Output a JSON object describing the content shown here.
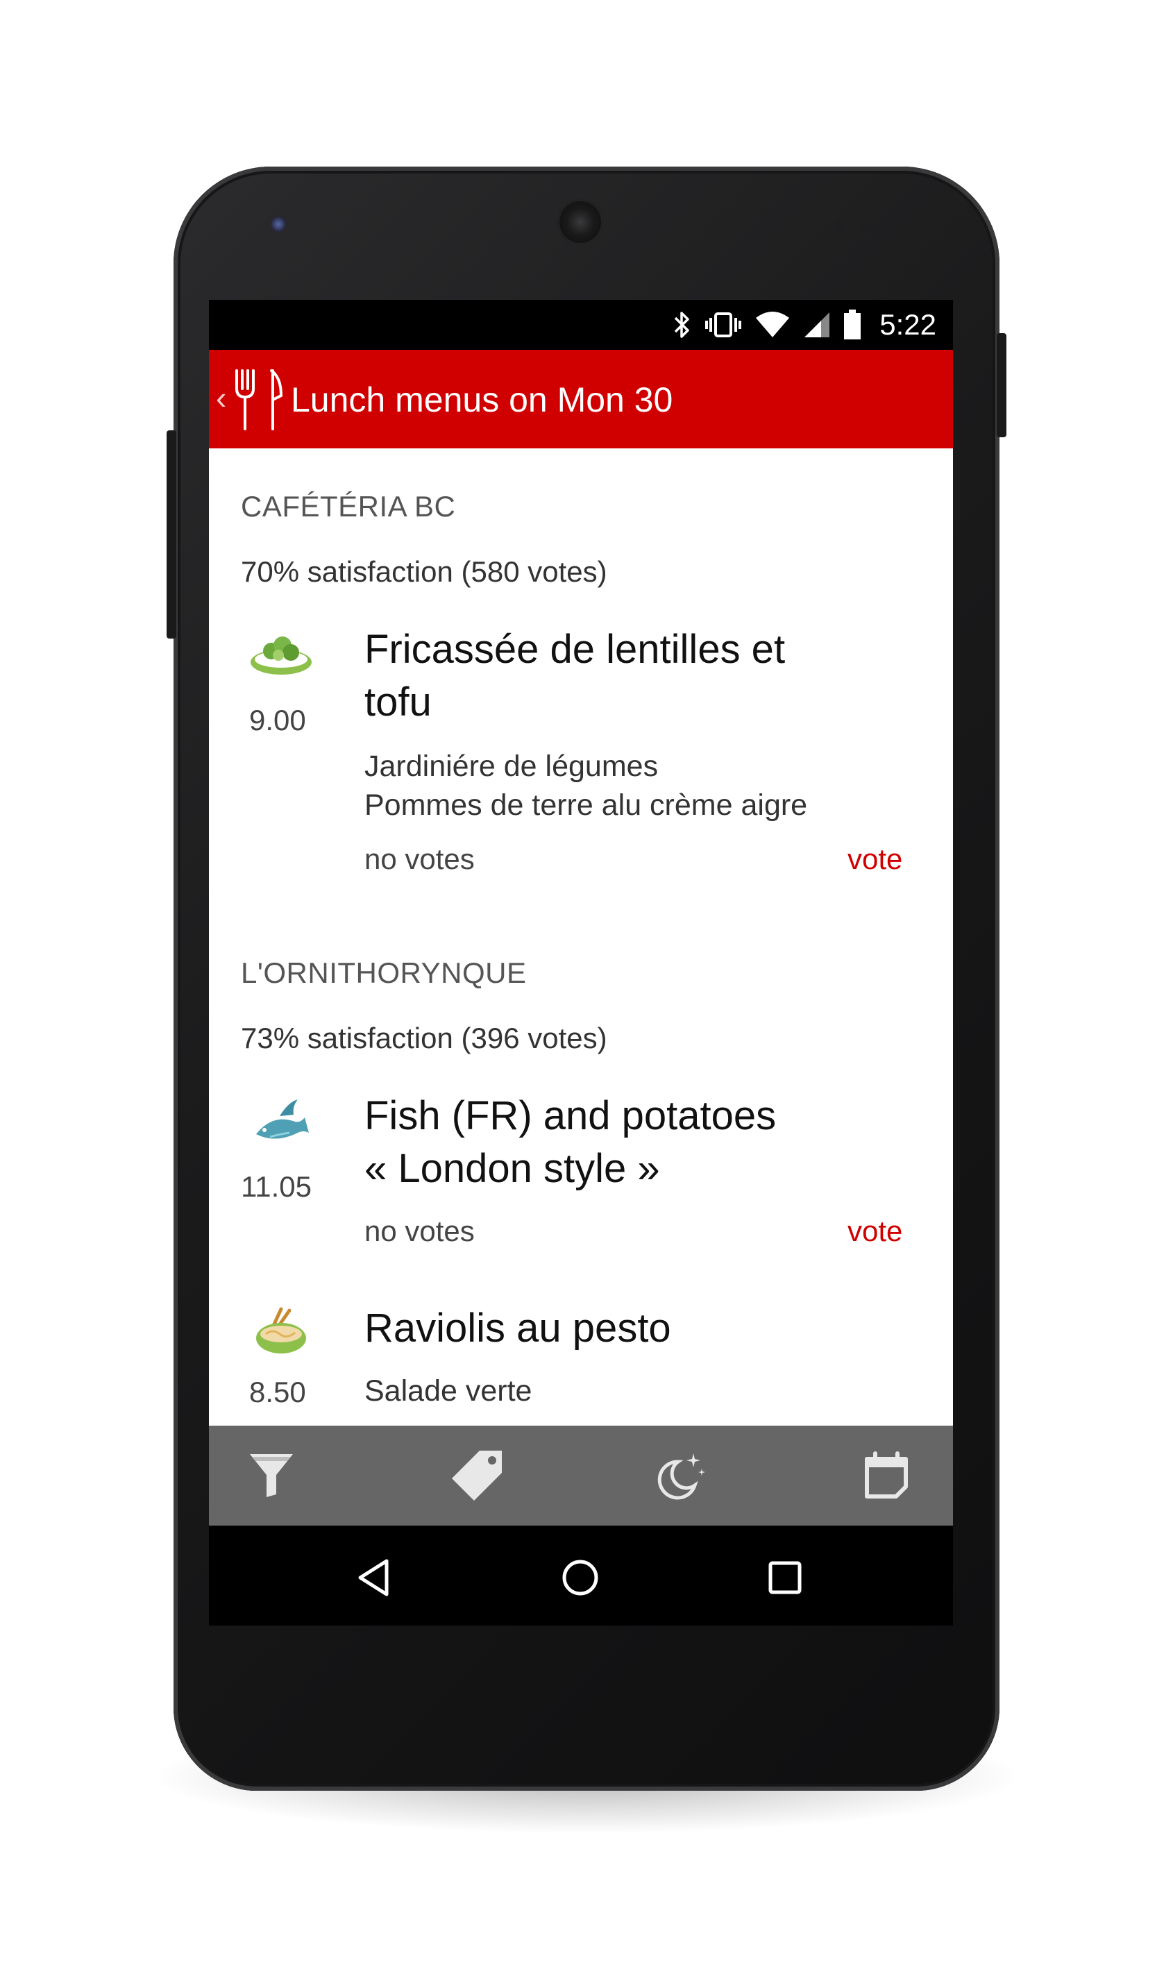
{
  "status_bar": {
    "time": "5:22",
    "icons": [
      "bluetooth-icon",
      "vibrate-icon",
      "wifi-icon",
      "signal-icon",
      "battery-icon"
    ]
  },
  "app_bar": {
    "title": "Lunch menus on Mon 30",
    "back_glyph": "‹",
    "icon": "fork-knife-icon"
  },
  "restaurants": [
    {
      "name": "CAFÉTÉRIA BC",
      "satisfaction": "70% satisfaction (580 votes)",
      "dishes": [
        {
          "icon": "salad-icon",
          "price": "9.00",
          "name_line1": "Fricassée de lentilles et",
          "name_line2": "tofu",
          "sides": [
            "Jardiniére de légumes",
            "Pommes de terre alu crème aigre"
          ],
          "votes": "no votes",
          "vote_label": "vote"
        }
      ]
    },
    {
      "name": "L'ORNITHORYNQUE",
      "satisfaction": "73% satisfaction (396 votes)",
      "dishes": [
        {
          "icon": "fish-icon",
          "price": "11.05",
          "name_line1": "Fish (FR) and potatoes",
          "name_line2": "« London style »",
          "votes": "no votes",
          "vote_label": "vote"
        },
        {
          "icon": "noodle-bowl-icon",
          "price": "8.50",
          "name_line1": "Raviolis au pesto",
          "sides": [
            "Salade verte"
          ]
        }
      ]
    }
  ],
  "toolbar": {
    "items": [
      "filter-icon",
      "tag-icon",
      "night-moon-icon",
      "calendar-icon"
    ]
  },
  "nav_bar": {
    "items": [
      "back-triangle-icon",
      "home-circle-icon",
      "recents-square-icon"
    ]
  },
  "colors": {
    "accent": "#d10000",
    "toolbar": "#666666",
    "vote_text": "#d10000"
  }
}
